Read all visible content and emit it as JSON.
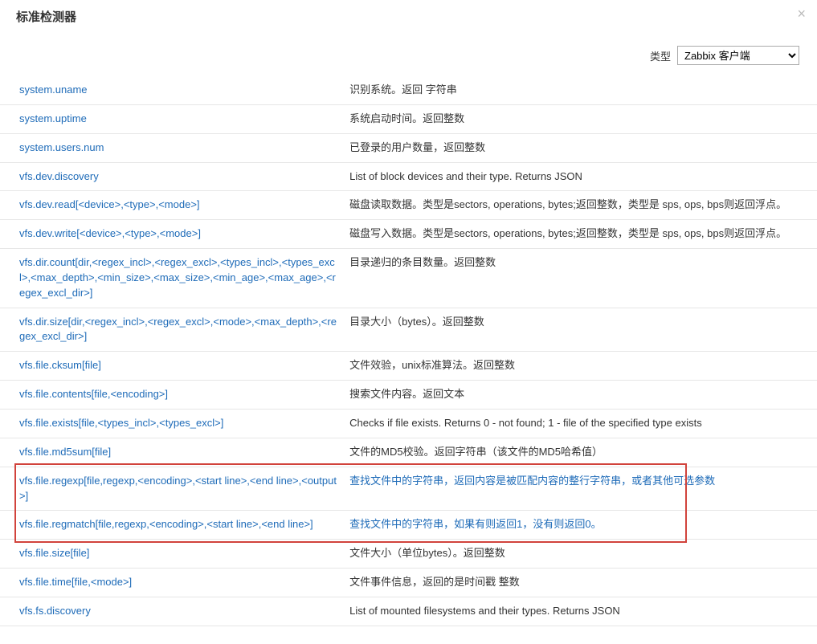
{
  "modal": {
    "title": "标准检测器",
    "close": "×"
  },
  "filter": {
    "label": "类型",
    "selected": "Zabbix 客户端"
  },
  "rows": [
    {
      "key": "system.uname",
      "desc": "识别系统。返回 字符串",
      "highlight": false
    },
    {
      "key": "system.uptime",
      "desc": "系统启动时间。返回整数",
      "highlight": false
    },
    {
      "key": "system.users.num",
      "desc": "已登录的用户数量，返回整数",
      "highlight": false
    },
    {
      "key": "vfs.dev.discovery",
      "desc": "List of block devices and their type. Returns JSON",
      "highlight": false
    },
    {
      "key": "vfs.dev.read[<device>,<type>,<mode>]",
      "desc": "磁盘读取数据。类型是sectors, operations, bytes;返回整数，类型是 sps, ops, bps则返回浮点。",
      "highlight": false
    },
    {
      "key": "vfs.dev.write[<device>,<type>,<mode>]",
      "desc": "磁盘写入数据。类型是sectors, operations, bytes;返回整数，类型是 sps, ops, bps则返回浮点。",
      "highlight": false
    },
    {
      "key": "vfs.dir.count[dir,<regex_incl>,<regex_excl>,<types_incl>,<types_excl>,<max_depth>,<min_size>,<max_size>,<min_age>,<max_age>,<regex_excl_dir>]",
      "desc": "目录递归的条目数量。返回整数",
      "highlight": false
    },
    {
      "key": "vfs.dir.size[dir,<regex_incl>,<regex_excl>,<mode>,<max_depth>,<regex_excl_dir>]",
      "desc": "目录大小（bytes）。返回整数",
      "highlight": false
    },
    {
      "key": "vfs.file.cksum[file]",
      "desc": "文件效验，unix标准算法。返回整数",
      "highlight": false
    },
    {
      "key": "vfs.file.contents[file,<encoding>]",
      "desc": "搜索文件内容。返回文本",
      "highlight": false
    },
    {
      "key": "vfs.file.exists[file,<types_incl>,<types_excl>]",
      "desc": "Checks if file exists. Returns 0 - not found; 1 - file of the specified type exists",
      "highlight": false
    },
    {
      "key": "vfs.file.md5sum[file]",
      "desc": "文件的MD5校验。返回字符串（该文件的MD5哈希值）",
      "highlight": false
    },
    {
      "key": "vfs.file.regexp[file,regexp,<encoding>,<start line>,<end line>,<output>]",
      "desc": "查找文件中的字符串，返回内容是被匹配内容的整行字符串，或者其他可选参数",
      "highlight": true
    },
    {
      "key": "vfs.file.regmatch[file,regexp,<encoding>,<start line>,<end line>]",
      "desc": "查找文件中的字符串，如果有则返回1，没有则返回0。",
      "highlight": true
    },
    {
      "key": "vfs.file.size[file]",
      "desc": "文件大小（单位bytes）。返回整数",
      "highlight": false
    },
    {
      "key": "vfs.file.time[file,<mode>]",
      "desc": "文件事件信息，返回的是时间戳 整数",
      "highlight": false
    },
    {
      "key": "vfs.fs.discovery",
      "desc": "List of mounted filesystems and their types. Returns JSON",
      "highlight": false
    }
  ],
  "highlight_box": {
    "top_row": 12,
    "bottom_row": 13
  }
}
